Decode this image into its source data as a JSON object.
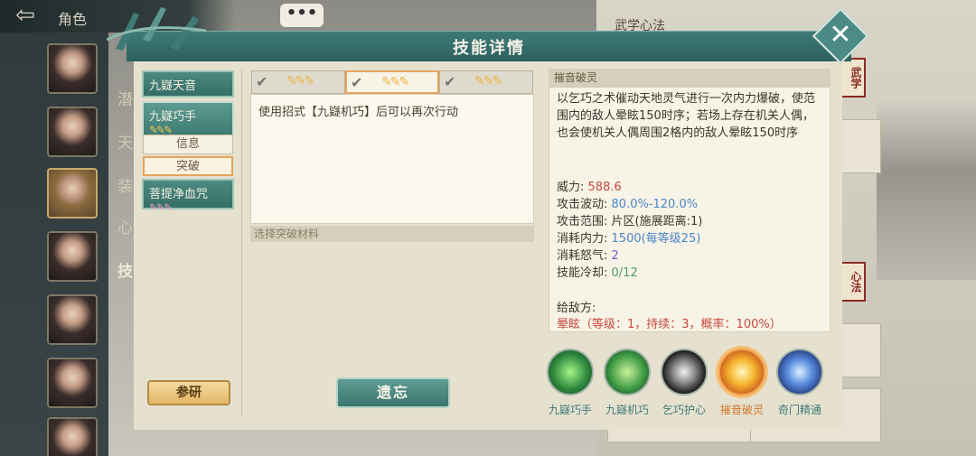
{
  "background": {
    "title": "角色",
    "left_labels": [
      "潜",
      "天",
      "装",
      "心",
      "技"
    ],
    "right_title": "武学心法",
    "right_seal_1": "武学",
    "right_seal_2": "心法",
    "chat": "•••"
  },
  "dialog": {
    "title": "技能详情",
    "close_label": "✕"
  },
  "left": {
    "skills": [
      {
        "label": "九嶷天音",
        "quills": ""
      },
      {
        "label": "九嶷巧手",
        "quills": "✎✎✎"
      },
      {
        "label": "菩提净血咒",
        "quills": "✎✎✎"
      }
    ],
    "sub_tabs": [
      "信息",
      "突破"
    ],
    "research_label": "参研"
  },
  "center": {
    "star_tabs": [
      {
        "check": "✔",
        "quills": "✎✎✎"
      },
      {
        "check": "✔",
        "quills": "✎✎✎"
      },
      {
        "check": "✔",
        "quills": "✎✎✎"
      }
    ],
    "effect_text": "使用招式【九嶷机巧】后可以再次行动",
    "material_header": "选择突破材料",
    "forget_label": "遗忘"
  },
  "right": {
    "header": "摧音破灵",
    "description": "以乞巧之术催动天地灵气进行一次内力爆破，使范围内的敌人晕眩150时序；若场上存在机关人偶，也会使机关人偶周围2格内的敌人晕眩150时序",
    "stats": {
      "power_label": "威力:",
      "power_value": "588.6",
      "wave_label": "攻击波动:",
      "wave_value": "80.0%-120.0%",
      "range_label": "攻击范围:",
      "range_value": "片区(施展距离:1)",
      "mp_label": "消耗内力:",
      "mp_value": "1500(每等级25)",
      "rage_label": "消耗怒气:",
      "rage_value": "2",
      "cd_label": "技能冷却:",
      "cd_value": "0/12"
    },
    "enemy_label": "给敌方:",
    "enemy_effect": "晕眩（等级：1，持续：3，概率：100%）",
    "skill_icons": [
      {
        "label": "九嶷巧手",
        "icon": "green-hand-icon"
      },
      {
        "label": "九嶷机巧",
        "icon": "green-mechanism-icon"
      },
      {
        "label": "乞巧护心",
        "icon": "gear-shield-icon"
      },
      {
        "label": "摧音破灵",
        "icon": "orange-burst-icon"
      },
      {
        "label": "奇门精通",
        "icon": "blue-pillar-icon"
      }
    ]
  },
  "colors": {
    "teal": "#3f7a77",
    "accent_orange": "#e7a45e",
    "value_red": "#c94a3f",
    "value_blue": "#4c86c8",
    "value_purple": "#7d5cc4",
    "value_green": "#4d9e62"
  }
}
